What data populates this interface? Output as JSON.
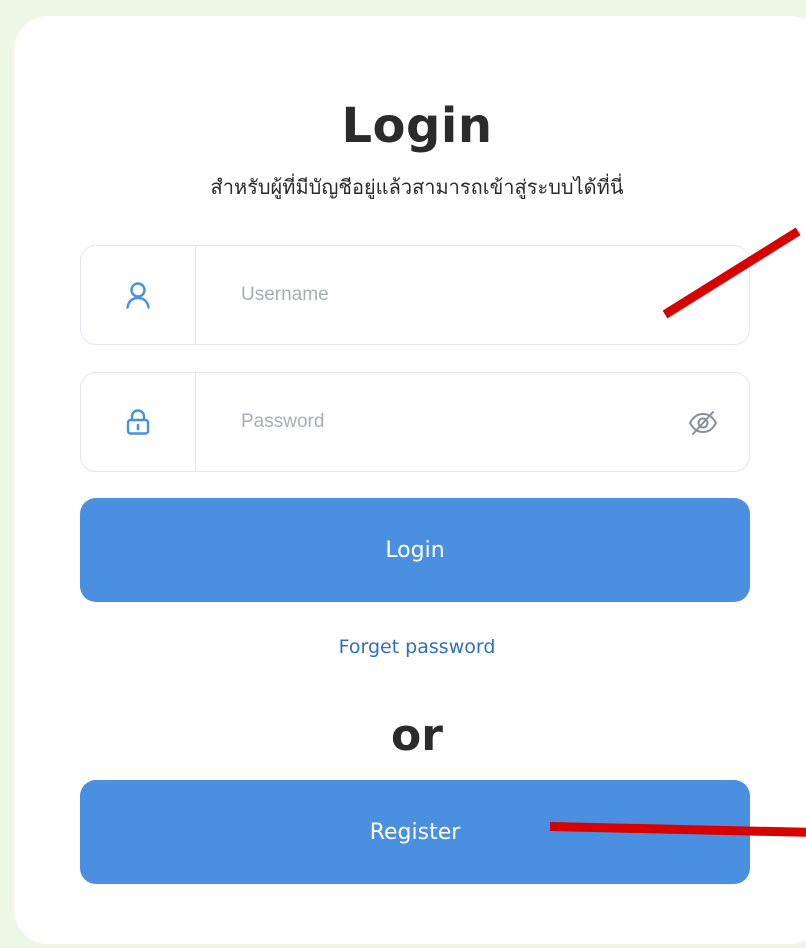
{
  "login": {
    "title": "Login",
    "subtitle": "สำหรับผู้ที่มีบัญชีอยู่แล้วสามารถเข้าสู่ระบบได้ที่นี่",
    "username": {
      "icon": "user-icon",
      "placeholder": "Username",
      "value": ""
    },
    "password": {
      "icon": "lock-icon",
      "placeholder": "Password",
      "value": "",
      "toggle_icon": "eye-off-icon"
    },
    "login_button": "Login",
    "forget_link": "Forget password",
    "separator": "or",
    "register_button": "Register"
  },
  "colors": {
    "page_background": "#eef6e6",
    "card_background": "#ffffff",
    "accent": "#4a8fe0",
    "link": "#2f6fbf",
    "text": "#2b2b2b",
    "placeholder": "#a9adb3",
    "annotation": "#d90000"
  }
}
